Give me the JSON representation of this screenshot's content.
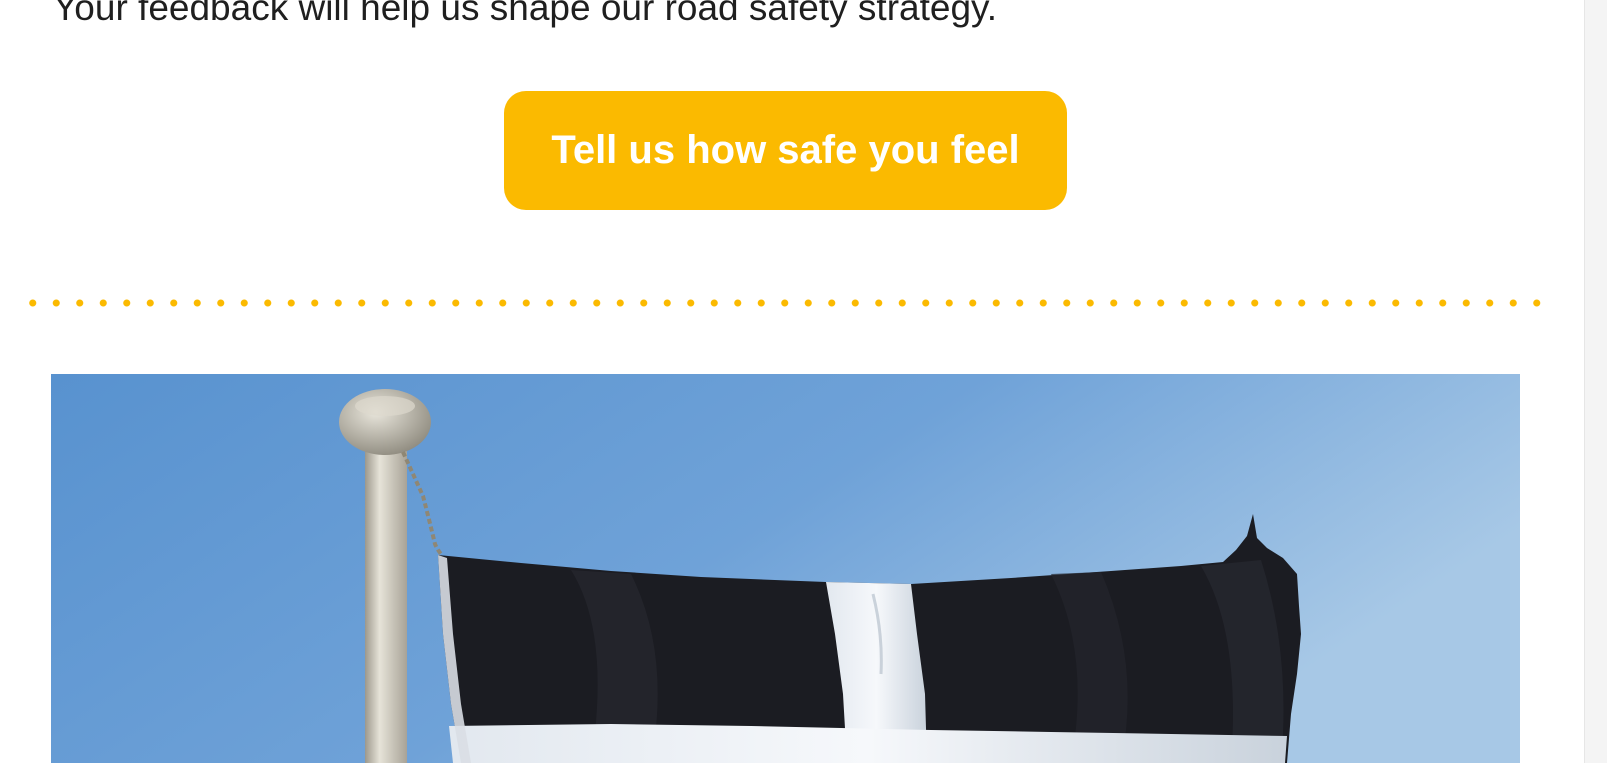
{
  "content": {
    "intro_text": "Your feedback will help us shape our road safety strategy.",
    "cta_label": "Tell us how safe you feel"
  },
  "image": {
    "subject": "flag-on-pole",
    "colors": {
      "sky_light": "#a7c8e6",
      "sky_dark": "#5892cf",
      "flag_black": "#1b1c22",
      "flag_white": "#eef2f6",
      "pole": "#d9d5c8",
      "accent": "#fbba00"
    }
  }
}
